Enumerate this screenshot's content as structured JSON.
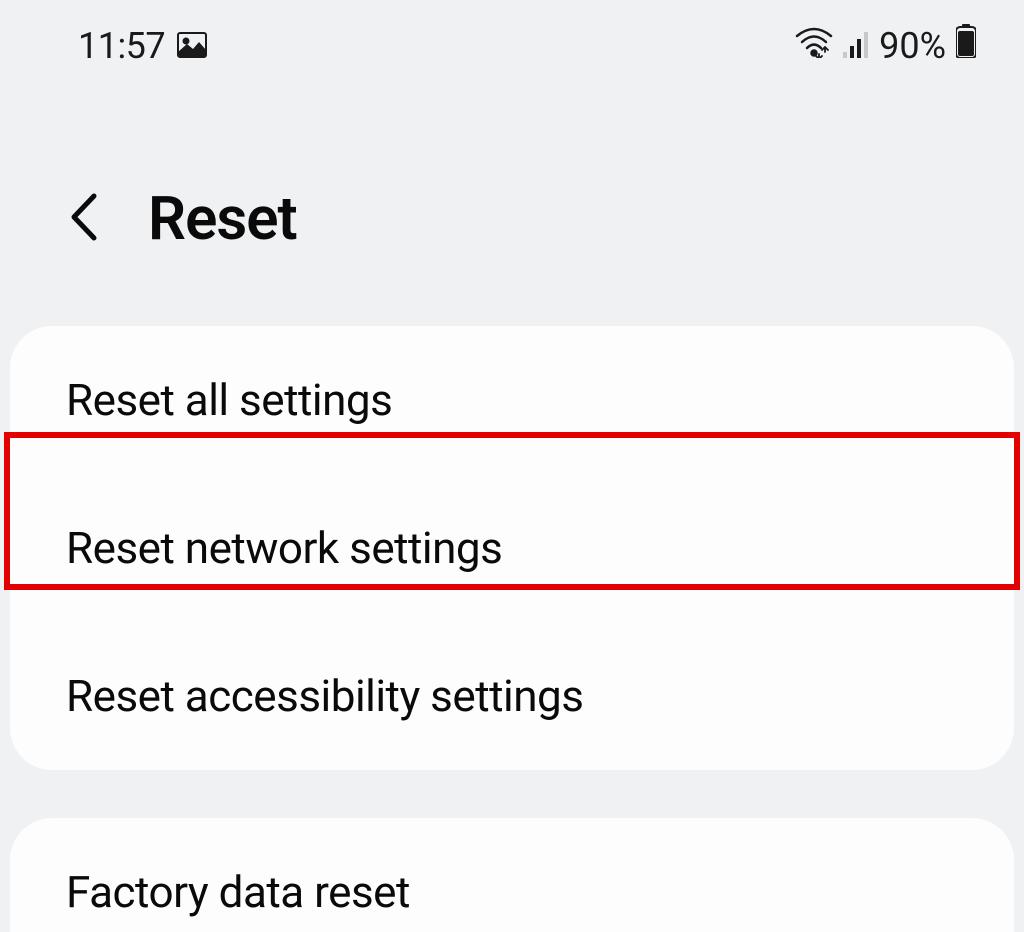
{
  "statusBar": {
    "time": "11:57",
    "batteryPercent": "90%"
  },
  "header": {
    "title": "Reset"
  },
  "listCard": {
    "items": [
      {
        "label": "Reset all settings"
      },
      {
        "label": "Reset network settings"
      },
      {
        "label": "Reset accessibility settings"
      }
    ]
  },
  "secondCard": {
    "title": "Factory data reset"
  }
}
